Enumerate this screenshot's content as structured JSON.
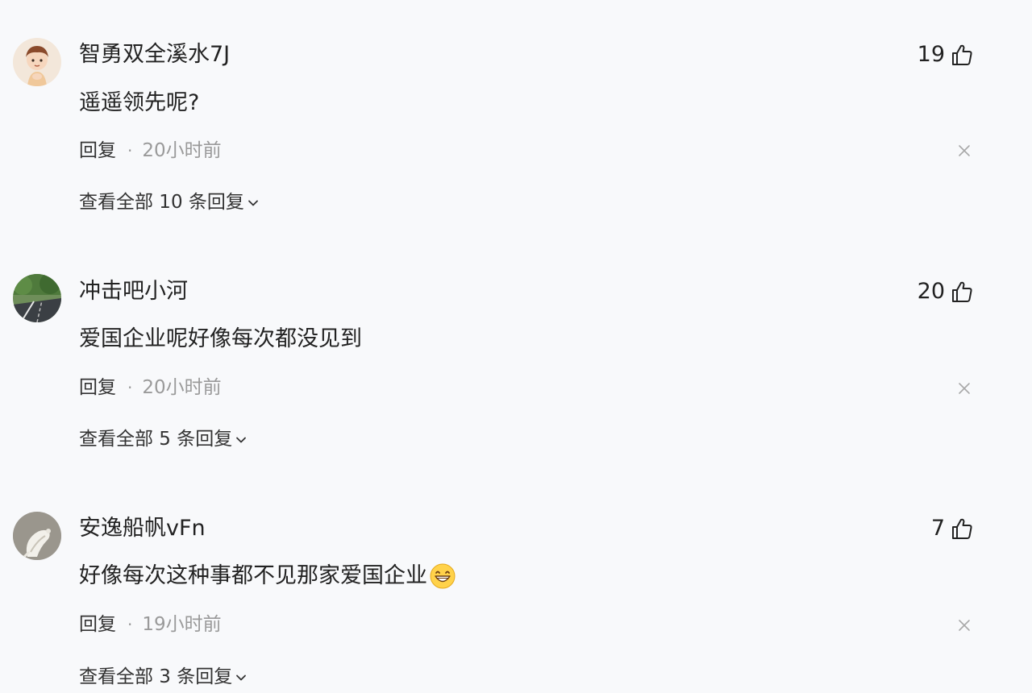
{
  "comments": [
    {
      "username": "智勇双全溪水7J",
      "likes": "19",
      "text": "遥遥领先呢?",
      "reply_label": "回复",
      "separator": "·",
      "time": "20小时前",
      "view_all": "查看全部 10 条回复"
    },
    {
      "username": "冲击吧小河",
      "likes": "20",
      "text": "爱国企业呢好像每次都没见到",
      "reply_label": "回复",
      "separator": "·",
      "time": "20小时前",
      "view_all": "查看全部 5 条回复"
    },
    {
      "username": "安逸船帆vFn",
      "likes": "7",
      "text": "好像每次这种事都不见那家爱国企业",
      "reply_label": "回复",
      "separator": "·",
      "time": "19小时前",
      "view_all": "查看全部 3 条回复"
    }
  ],
  "icons": {
    "like": "thumbs-up-icon",
    "close": "close-icon",
    "expand": "chevron-down-icon",
    "emoji": "grin-emoji-icon"
  },
  "colors": {
    "background": "#f8f9fb",
    "primary_text": "#222222",
    "secondary_text": "#9a9a9a"
  }
}
